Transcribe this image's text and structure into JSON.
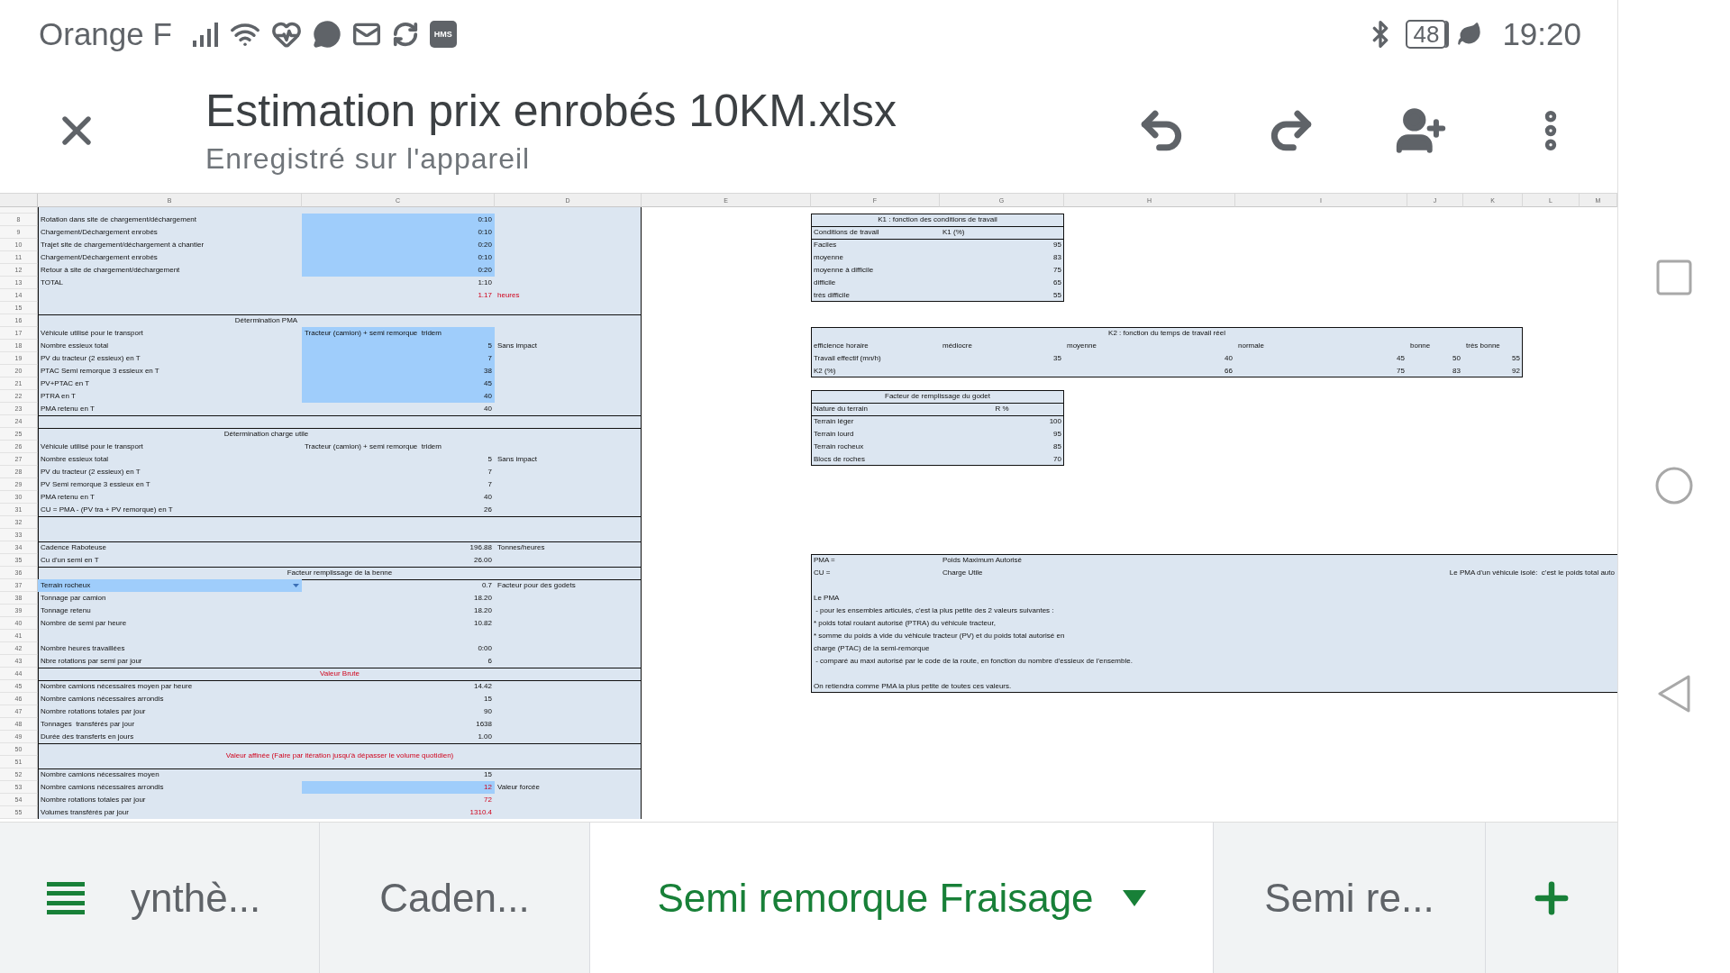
{
  "status_bar": {
    "carrier": "Orange F",
    "app_badge": "HMS",
    "battery": "48",
    "time": "19:20"
  },
  "document": {
    "title": "Estimation prix enrobés 10KM.xlsx",
    "subtitle": "Enregistré sur l'appareil"
  },
  "sheet": {
    "column_headers": [
      "B",
      "C",
      "D",
      "E",
      "F",
      "G",
      "H",
      "I",
      "J",
      "K",
      "L",
      "M"
    ],
    "rows": [
      {
        "number": "8",
        "left": {
          "top": false,
          "cells": {
            "b": {
              "text": "Rotation dans site de chargement/déchargement"
            },
            "c": {
              "text": "0:10",
              "numeric": true,
              "input": true
            }
          }
        },
        "right": {
          "kind": "narrow",
          "top": true,
          "bottom": false,
          "cells": {
            "fg": {
              "text": "K1 : fonction des conditions de travail",
              "heading": true
            }
          }
        }
      },
      {
        "number": "9",
        "left": {
          "top": false,
          "cells": {
            "b": {
              "text": "Chargement/Déchargement enrobés"
            },
            "c": {
              "text": "0:10",
              "numeric": true,
              "input": true
            }
          }
        },
        "right": {
          "kind": "narrow",
          "top": true,
          "bottom": false,
          "cells": {
            "f": {
              "text": "Conditions de travail"
            },
            "g": {
              "text": "K1 (%)"
            }
          }
        }
      },
      {
        "number": "10",
        "left": {
          "top": false,
          "cells": {
            "b": {
              "text": "Trajet site de chargement/déchargement à chantier"
            },
            "c": {
              "text": "0:20",
              "numeric": true,
              "input": true
            }
          }
        },
        "right": {
          "kind": "narrow",
          "top": true,
          "bottom": false,
          "cells": {
            "f": {
              "text": "Faciles"
            },
            "g": {
              "text": "95",
              "numeric": true
            }
          }
        }
      },
      {
        "number": "11",
        "left": {
          "top": false,
          "cells": {
            "b": {
              "text": "Chargement/Déchargement enrobés"
            },
            "c": {
              "text": "0:10",
              "numeric": true,
              "input": true
            }
          }
        },
        "right": {
          "kind": "narrow",
          "top": false,
          "bottom": false,
          "cells": {
            "f": {
              "text": "moyenne"
            },
            "g": {
              "text": "83",
              "numeric": true
            }
          }
        }
      },
      {
        "number": "12",
        "left": {
          "top": false,
          "cells": {
            "b": {
              "text": "Retour à site de chargement/déchargement"
            },
            "c": {
              "text": "0:20",
              "numeric": true,
              "input": true
            }
          }
        },
        "right": {
          "kind": "narrow",
          "top": false,
          "bottom": false,
          "cells": {
            "f": {
              "text": "moyenne à difficile"
            },
            "g": {
              "text": "75",
              "numeric": true
            }
          }
        }
      },
      {
        "number": "13",
        "left": {
          "top": false,
          "cells": {
            "b": {
              "text": "TOTAL"
            },
            "c": {
              "text": "1:10",
              "numeric": true
            }
          }
        },
        "right": {
          "kind": "narrow",
          "top": false,
          "bottom": false,
          "cells": {
            "f": {
              "text": "difficile"
            },
            "g": {
              "text": "65",
              "numeric": true
            }
          }
        }
      },
      {
        "number": "14",
        "left": {
          "top": false,
          "cells": {
            "c": {
              "text": "1.17",
              "numeric": true,
              "warning": true
            },
            "d": {
              "text": "heures",
              "warning": true
            }
          }
        },
        "right": {
          "kind": "narrow",
          "top": false,
          "bottom": true,
          "cells": {
            "f": {
              "text": "très difficile"
            },
            "g": {
              "text": "55",
              "numeric": true
            }
          }
        }
      },
      {
        "number": "15",
        "left": {
          "top": false
        }
      },
      {
        "number": "16",
        "left": {
          "top": true,
          "cells": {
            "bc": {
              "text": "Détermination PMA",
              "heading": true
            }
          }
        }
      },
      {
        "number": "17",
        "left": {
          "top": false,
          "cells": {
            "b": {
              "text": "Véhicule utilisé pour le transport"
            },
            "c": {
              "text": "Tracteur (camion) + semi remorque  tridem",
              "input": true
            }
          }
        },
        "right": {
          "kind": "wide",
          "top": true,
          "bottom": false,
          "cells": {
            "fk": {
              "text": "K2 : fonction du temps de travail réel",
              "heading": true
            }
          }
        }
      },
      {
        "number": "18",
        "left": {
          "top": false,
          "cells": {
            "b": {
              "text": "Nombre essieux total"
            },
            "c": {
              "text": "5",
              "numeric": true,
              "input": true
            },
            "d": {
              "text": "Sans impact"
            }
          }
        },
        "right": {
          "kind": "wide",
          "top": false,
          "bottom": false,
          "cells": {
            "f": {
              "text": "efficience horaire"
            },
            "g": {
              "text": "médiocre"
            },
            "h": {
              "text": "moyenne"
            },
            "i": {
              "text": "normale"
            },
            "j": {
              "text": "bonne"
            },
            "k": {
              "text": "très bonne"
            }
          }
        }
      },
      {
        "number": "19",
        "left": {
          "top": false,
          "cells": {
            "b": {
              "text": "PV du tracteur (2 essieux) en T"
            },
            "c": {
              "text": "7",
              "numeric": true,
              "input": true
            }
          }
        },
        "right": {
          "kind": "wide",
          "top": false,
          "bottom": false,
          "cells": {
            "f": {
              "text": "Travail effectif (mn/h)"
            },
            "g": {
              "text": "35",
              "numeric": true
            },
            "h": {
              "text": "40",
              "numeric": true
            },
            "i": {
              "text": "45",
              "numeric": true
            },
            "j": {
              "text": "50",
              "numeric": true
            },
            "k": {
              "text": "55",
              "numeric": true
            }
          }
        }
      },
      {
        "number": "20",
        "left": {
          "top": false,
          "cells": {
            "b": {
              "text": "PTAC Semi remorque 3 essieux en T"
            },
            "c": {
              "text": "38",
              "numeric": true,
              "input": true
            }
          }
        },
        "right": {
          "kind": "wide",
          "top": false,
          "bottom": true,
          "cells": {
            "f": {
              "text": "K2 (%)"
            },
            "h": {
              "text": "66",
              "numeric": true
            },
            "i": {
              "text": "75",
              "numeric": true
            },
            "j": {
              "text": "83",
              "numeric": true
            },
            "k": {
              "text": "92",
              "numeric": true
            }
          }
        }
      },
      {
        "number": "21",
        "left": {
          "top": false,
          "cells": {
            "b": {
              "text": "PV+PTAC en T"
            },
            "c": {
              "text": "45",
              "numeric": true,
              "input": true
            }
          }
        }
      },
      {
        "number": "22",
        "left": {
          "top": false,
          "cells": {
            "b": {
              "text": "PTRA en T"
            },
            "c": {
              "text": "40",
              "numeric": true,
              "input": true
            }
          }
        },
        "right": {
          "kind": "narrow",
          "top": true,
          "bottom": false,
          "cells": {
            "fg": {
              "text": "Facteur de remplissage du godet",
              "heading": true
            }
          }
        }
      },
      {
        "number": "23",
        "left": {
          "top": false,
          "cells": {
            "b": {
              "text": "PMA retenu en T"
            },
            "c": {
              "text": "40",
              "numeric": true
            }
          }
        },
        "right": {
          "kind": "narrow",
          "top": true,
          "bottom": false,
          "cells": {
            "f": {
              "text": "Nature du terrain"
            },
            "g": {
              "text": "R %",
              "heading": true
            }
          }
        }
      },
      {
        "number": "24",
        "left": {
          "top": true
        },
        "right": {
          "kind": "narrow",
          "top": true,
          "bottom": false,
          "cells": {
            "f": {
              "text": "Terrain léger"
            },
            "g": {
              "text": "100",
              "numeric": true
            }
          }
        }
      },
      {
        "number": "25",
        "left": {
          "top": true,
          "cells": {
            "bc": {
              "text": "Détermination charge utile",
              "heading": true
            }
          }
        },
        "right": {
          "kind": "narrow",
          "top": false,
          "bottom": false,
          "cells": {
            "f": {
              "text": "Terrain lourd"
            },
            "g": {
              "text": "95",
              "numeric": true
            }
          }
        }
      },
      {
        "number": "26",
        "left": {
          "top": false,
          "cells": {
            "b": {
              "text": "Véhicule utilisé pour le transport"
            },
            "c": {
              "text": "Tracteur (camion) + semi remorque  tridem"
            }
          }
        },
        "right": {
          "kind": "narrow",
          "top": false,
          "bottom": false,
          "cells": {
            "f": {
              "text": "Terrain rocheux"
            },
            "g": {
              "text": "85",
              "numeric": true
            }
          }
        }
      },
      {
        "number": "27",
        "left": {
          "top": false,
          "cells": {
            "b": {
              "text": "Nombre essieux total"
            },
            "c": {
              "text": "5",
              "numeric": true
            },
            "d": {
              "text": "Sans impact"
            }
          }
        },
        "right": {
          "kind": "narrow",
          "top": false,
          "bottom": true,
          "cells": {
            "f": {
              "text": "Blocs de roches"
            },
            "g": {
              "text": "70",
              "numeric": true
            }
          }
        }
      },
      {
        "number": "28",
        "left": {
          "top": false,
          "cells": {
            "b": {
              "text": "PV du tracteur (2 essieux) en T"
            },
            "c": {
              "text": "7",
              "numeric": true
            }
          }
        }
      },
      {
        "number": "29",
        "left": {
          "top": false,
          "cells": {
            "b": {
              "text": "PV Semi remorque 3 essieux en T"
            },
            "c": {
              "text": "7",
              "numeric": true
            }
          }
        }
      },
      {
        "number": "30",
        "left": {
          "top": false,
          "cells": {
            "b": {
              "text": "PMA retenu en T"
            },
            "c": {
              "text": "40",
              "numeric": true
            }
          }
        }
      },
      {
        "number": "31",
        "left": {
          "top": false,
          "cells": {
            "b": {
              "text": "CU = PMA - (PV tra + PV remorque) en T"
            },
            "c": {
              "text": "26",
              "numeric": true
            }
          }
        }
      },
      {
        "number": "32",
        "left": {
          "top": true
        }
      },
      {
        "number": "33",
        "left": {
          "top": false
        }
      },
      {
        "number": "34",
        "left": {
          "top": true,
          "cells": {
            "b": {
              "text": "Cadence Raboteuse"
            },
            "c": {
              "text": "196.88",
              "numeric": true
            },
            "d": {
              "text": "Tonnes/heures"
            }
          }
        }
      },
      {
        "number": "35",
        "left": {
          "top": false,
          "cells": {
            "b": {
              "text": "Cu d'un semi en T"
            },
            "c": {
              "text": "26.00",
              "numeric": true
            }
          }
        },
        "right": {
          "kind": "full",
          "top": true,
          "bottom": false,
          "cells": {
            "f": {
              "text": "PMA ="
            },
            "g": {
              "text": "Poids Maximum Autorisé"
            }
          }
        }
      },
      {
        "number": "36",
        "left": {
          "top": true,
          "cells": {
            "bd": {
              "text": "Facteur remplissage de la benne",
              "heading": true
            }
          }
        },
        "right": {
          "kind": "full",
          "top": false,
          "bottom": false,
          "cells": {
            "f": {
              "text": "CU ="
            },
            "g": {
              "text": "Charge Utile"
            },
            "im": {
              "text": "Le PMA d'un véhicule isolé:  c'est le poids total auto",
              "numeric": true
            }
          }
        }
      },
      {
        "number": "37",
        "left": {
          "top": true,
          "cells": {
            "b": {
              "text": "Terrain rocheux",
              "dropdown": true
            },
            "c": {
              "text": "0.7",
              "numeric": true
            },
            "d": {
              "text": "Facteur pour des godets"
            }
          }
        },
        "right": {
          "kind": "full",
          "top": false,
          "bottom": false
        }
      },
      {
        "number": "38",
        "left": {
          "top": false,
          "cells": {
            "b": {
              "text": "Tonnage par camion"
            },
            "c": {
              "text": "18.20",
              "numeric": true
            }
          }
        },
        "right": {
          "kind": "full",
          "top": false,
          "bottom": false,
          "cells": {
            "fm": {
              "text": "Le PMA"
            }
          }
        }
      },
      {
        "number": "39",
        "left": {
          "top": false,
          "cells": {
            "b": {
              "text": "Tonnage retenu"
            },
            "c": {
              "text": "18.20",
              "numeric": true
            }
          }
        },
        "right": {
          "kind": "full",
          "top": false,
          "bottom": false,
          "cells": {
            "fm": {
              "text": " - pour les ensembles articulés, c'est la plus petite des 2 valeurs suivantes :"
            }
          }
        }
      },
      {
        "number": "40",
        "left": {
          "top": false,
          "cells": {
            "b": {
              "text": "Nombre de semi par heure"
            },
            "c": {
              "text": "10.82",
              "numeric": true
            }
          }
        },
        "right": {
          "kind": "full",
          "top": false,
          "bottom": false,
          "cells": {
            "fm": {
              "text": "* poids total roulant autorisé (PTRA) du véhicule tracteur,"
            }
          }
        }
      },
      {
        "number": "41",
        "left": {
          "top": false
        },
        "right": {
          "kind": "full",
          "top": false,
          "bottom": false,
          "cells": {
            "fm": {
              "text": "* somme du poids à vide du véhicule tracteur (PV) et du poids total autorisé en"
            }
          }
        }
      },
      {
        "number": "42",
        "left": {
          "top": false,
          "cells": {
            "b": {
              "text": "Nombre heures travaillées"
            },
            "c": {
              "text": "0:00",
              "numeric": true
            }
          }
        },
        "right": {
          "kind": "full",
          "top": false,
          "bottom": false,
          "cells": {
            "fm": {
              "text": "charge (PTAC) de la semi-remorque"
            }
          }
        }
      },
      {
        "number": "43",
        "left": {
          "top": false,
          "cells": {
            "b": {
              "text": "Nbre rotations par semi par jour"
            },
            "c": {
              "text": "6",
              "numeric": true
            }
          }
        },
        "right": {
          "kind": "full",
          "top": false,
          "bottom": false,
          "cells": {
            "fm": {
              "text": " - comparé au maxi autorisé par le code de la route, en fonction du nombre d'essieux de l'ensemble."
            }
          }
        }
      },
      {
        "number": "44",
        "left": {
          "top": true,
          "cells": {
            "bd": {
              "text": "Valeur Brute",
              "heading": true,
              "warning": true
            }
          }
        },
        "right": {
          "kind": "full",
          "top": false,
          "bottom": false
        }
      },
      {
        "number": "45",
        "left": {
          "top": true,
          "cells": {
            "b": {
              "text": "Nombre camions nécessaires moyen par heure"
            },
            "c": {
              "text": "14.42",
              "numeric": true
            }
          }
        },
        "right": {
          "kind": "full",
          "top": false,
          "bottom": true,
          "cells": {
            "fm": {
              "text": "On retiendra comme PMA la plus petite de toutes ces valeurs."
            }
          }
        }
      },
      {
        "number": "46",
        "left": {
          "top": false,
          "cells": {
            "b": {
              "text": "Nombre camions nécessaires arrondis"
            },
            "c": {
              "text": "15",
              "numeric": true
            }
          }
        }
      },
      {
        "number": "47",
        "left": {
          "top": false,
          "cells": {
            "b": {
              "text": "Nombre rotations totales par jour"
            },
            "c": {
              "text": "90",
              "numeric": true
            }
          }
        }
      },
      {
        "number": "48",
        "left": {
          "top": false,
          "cells": {
            "b": {
              "text": "Tonnages  transférés par jour"
            },
            "c": {
              "text": "1638",
              "numeric": true
            }
          }
        }
      },
      {
        "number": "49",
        "left": {
          "top": false,
          "cells": {
            "b": {
              "text": "Durée des transferts en jours"
            },
            "c": {
              "text": "1.00",
              "numeric": true
            }
          }
        }
      },
      {
        "number": "50",
        "left": {
          "top": true,
          "cells": {
            "bd": {
              "text": "Valeur affinée (Faire par itération jusqu'à dépasser le volume quotidien)",
              "heading": true,
              "warning": true,
              "tall": true
            }
          }
        }
      },
      {
        "number": "51",
        "left": {
          "top": false
        }
      },
      {
        "number": "52",
        "left": {
          "top": true,
          "cells": {
            "b": {
              "text": "Nombre camions nécessaires moyen"
            },
            "c": {
              "text": "15",
              "numeric": true
            }
          }
        }
      },
      {
        "number": "53",
        "left": {
          "top": false,
          "cells": {
            "b": {
              "text": "Nombre camions nécessaires arrondis"
            },
            "c": {
              "text": "12",
              "numeric": true,
              "input": true,
              "warning": true
            },
            "d": {
              "text": "Valeur forcée"
            }
          }
        }
      },
      {
        "number": "54",
        "left": {
          "top": false,
          "cells": {
            "b": {
              "text": "Nombre rotations totales par jour"
            },
            "c": {
              "text": "72",
              "numeric": true,
              "warning": true
            }
          }
        }
      },
      {
        "number": "55",
        "left": {
          "top": false,
          "cells": {
            "b": {
              "text": "Volumes transférés par jour"
            },
            "c": {
              "text": "1310.4",
              "numeric": true,
              "warning": true
            }
          }
        }
      }
    ]
  },
  "sheet_tabs": [
    {
      "label": "ynthè...",
      "selected": false
    },
    {
      "label": "Caden...",
      "selected": false
    },
    {
      "label": "Semi remorque Fraisage",
      "selected": true
    },
    {
      "label": "Semi re...",
      "selected": false
    }
  ]
}
